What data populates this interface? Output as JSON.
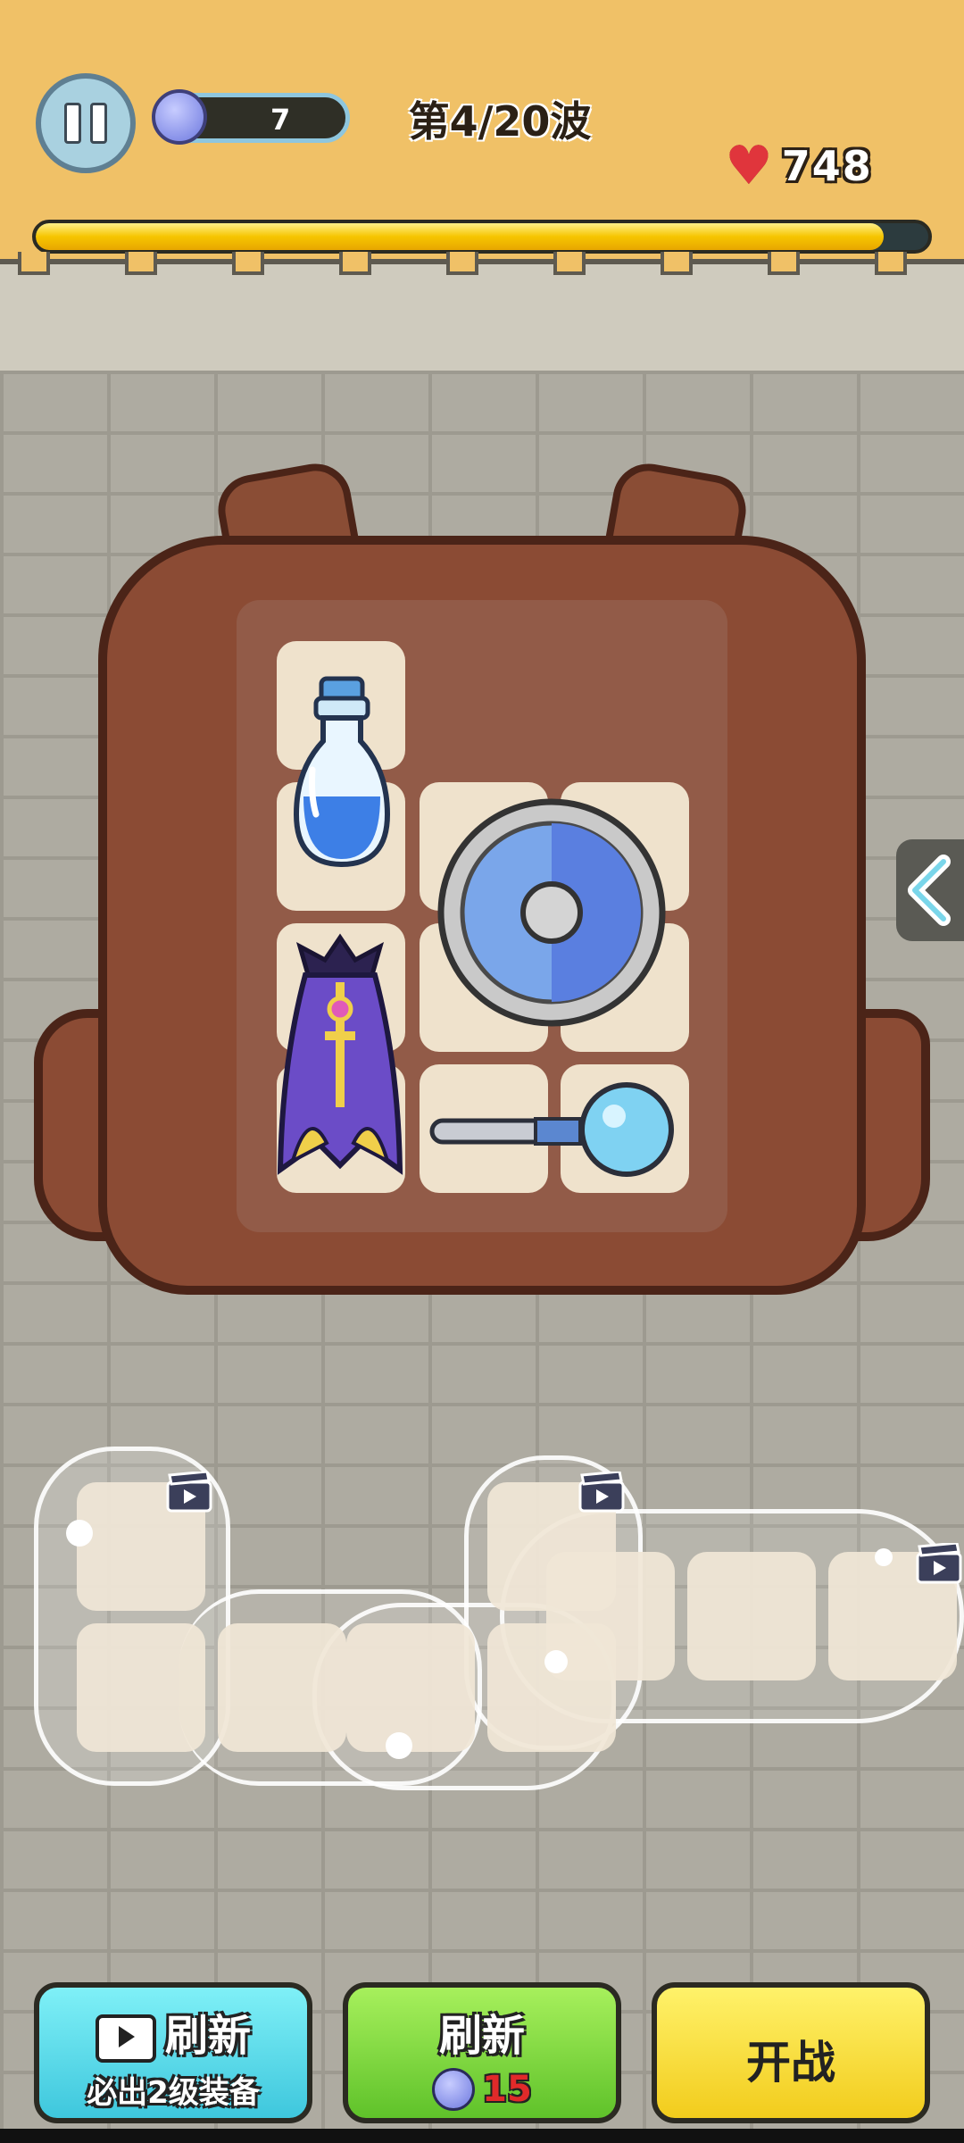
{
  "hud": {
    "gem_count": "7",
    "wave_label": "第4/20波",
    "hp_value": "748",
    "wave_progress": 0.95
  },
  "backpack": {
    "items": [
      {
        "name": "blue-potion"
      },
      {
        "name": "round-shield"
      },
      {
        "name": "purple-cape"
      },
      {
        "name": "crystal-wand"
      }
    ]
  },
  "buttons": {
    "ad_refresh_label": "刷新",
    "ad_refresh_sub": "必出2级装备",
    "refresh_label": "刷新",
    "refresh_cost": "15",
    "fight_label": "开战"
  },
  "colors": {
    "top_bar": "#f0c167",
    "progress_fill": "#f6c500",
    "ad_button": "#4fd6e6",
    "refresh_button": "#79d63b",
    "fight_button": "#f7dc2f",
    "heart": "#e0353c"
  }
}
